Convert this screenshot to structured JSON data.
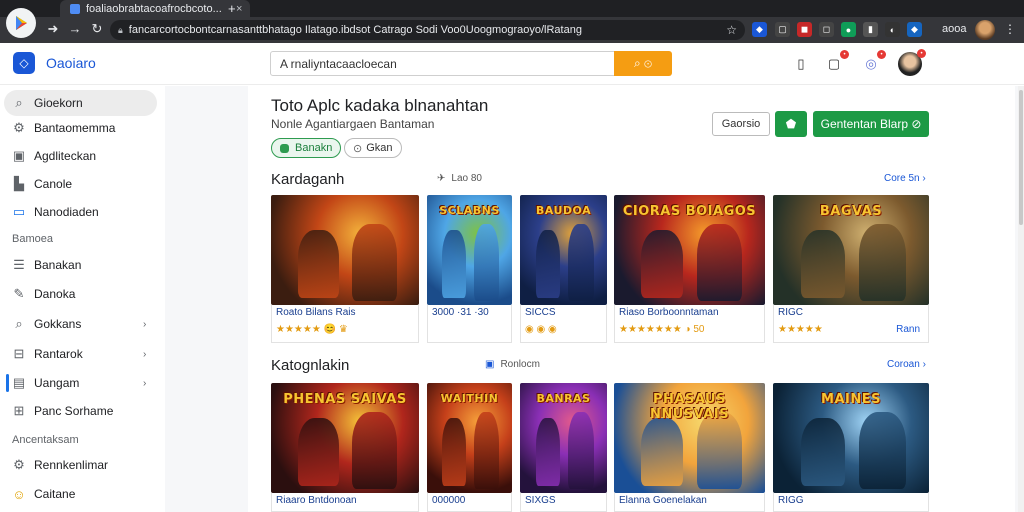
{
  "browser": {
    "tab_title": "foaliaobrabtacoafrocbcoto...",
    "tab_close": "×",
    "new_tab": "+",
    "url": "fancarcortocbontcarnasanttbhatago Ilatago.ibdsot Catrago Sodi Voo0Uoogmograoyo/lRatang",
    "profile_name": "aooa"
  },
  "app": {
    "brand": "Oaoiaro",
    "search_placeholder": "A rnaliyntacaacloecan",
    "search_button": "⌕ ⊙"
  },
  "sidebar": {
    "items": [
      {
        "label": "Gioekorn",
        "icon": "search-icon"
      },
      {
        "label": "Bantaomemma",
        "icon": "gear-icon"
      },
      {
        "label": "Agdliteckan",
        "icon": "briefcase-icon"
      },
      {
        "label": "Canole",
        "icon": "store-icon"
      },
      {
        "label": "Nanodiaden",
        "icon": "chat-icon"
      }
    ],
    "section1": "Bamoea",
    "items2": [
      {
        "label": "Banakan",
        "icon": "list-icon",
        "chevron": ""
      },
      {
        "label": "Danoka",
        "icon": "pen-icon",
        "chevron": ""
      },
      {
        "label": "Gokkans",
        "icon": "search-icon",
        "chevron": "›"
      },
      {
        "label": "Rantarok",
        "icon": "inbox-icon",
        "chevron": "›"
      },
      {
        "label": "Uangam",
        "icon": "doc-icon",
        "chevron": "›"
      },
      {
        "label": "Panc Sorhame",
        "icon": "grid-icon",
        "chevron": ""
      }
    ],
    "section2": "Ancentaksam",
    "items3": [
      {
        "label": "Rennkenlimar",
        "icon": "settings-icon"
      },
      {
        "label": "Caitane",
        "icon": "emoji-icon"
      }
    ]
  },
  "main": {
    "title": "Toto Aplc kadaka blnanahtan",
    "subtitle": "Nonle Agantiargaen Bantaman",
    "chips": [
      "Banakn",
      "Gkan"
    ],
    "btn_outline": "Gaorsio",
    "btn_green": "Gententan Blarp ⊘",
    "section1": {
      "title": "Kardaganh",
      "meta": "Lao 80",
      "link": "Core 5n ›"
    },
    "section2": {
      "title": "Katognlakin",
      "meta": "Ronlocm",
      "link": "Coroan ›"
    }
  },
  "row1": [
    {
      "name": "Roato Bilans Rais",
      "rating": "★★★★★ 😊 ♛",
      "extra": "",
      "art_title": ""
    },
    {
      "name": "3000 ·31 ·30",
      "rating": "",
      "extra": "",
      "art_title": "SCLABNS"
    },
    {
      "name": "SICCS",
      "rating": "◉ ◉ ◉",
      "extra": "",
      "art_title": "BAUDOA"
    },
    {
      "name": "Riaso Borboonntaman",
      "rating": "★★★★★★★ ◑ 50",
      "extra": "",
      "art_title": "CIORAS  BOIAGOS"
    },
    {
      "name": "RIGC",
      "rating": "★★★★★",
      "extra": "Rann",
      "art_title": "BAGVAS"
    }
  ],
  "row2": [
    {
      "name": "Riaaro Bntdonoan",
      "art_title": "PHENAS SAIVAS"
    },
    {
      "name": "000000",
      "art_title": "WAITHIN"
    },
    {
      "name": "SIXGS",
      "art_title": "BANRAS"
    },
    {
      "name": "Elanna Goenelakan",
      "art_title": "PHASAUS NNUSVAIS"
    },
    {
      "name": "RIGG",
      "art_title": "MAINES"
    }
  ],
  "colors": {
    "brand": "#1a57d6",
    "accent_orange": "#f59d12",
    "accent_green": "#1d9a45"
  }
}
